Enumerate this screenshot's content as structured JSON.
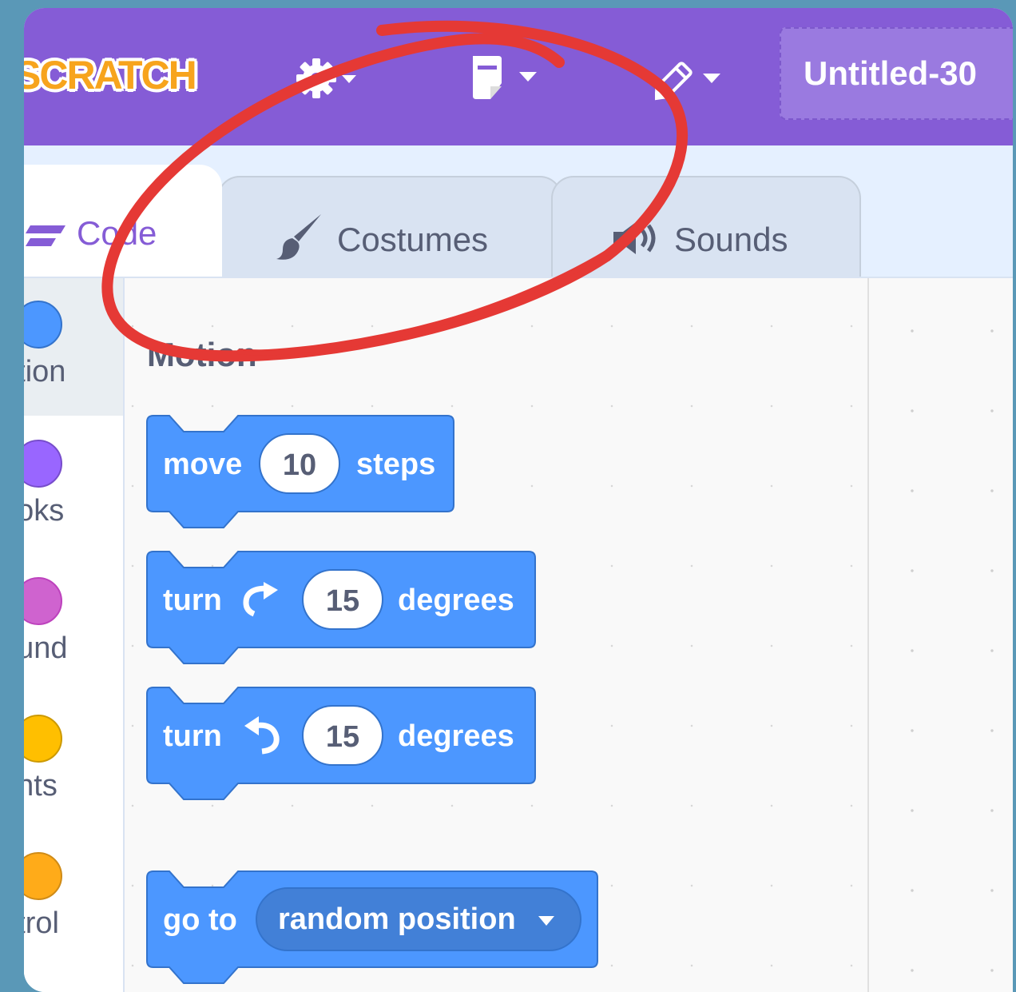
{
  "menubar": {
    "logo_text": "SCRATCH",
    "settings_icon": "gear-icon",
    "file_icon": "file-icon",
    "edit_icon": "edit-pencil-icon",
    "project_title": "Untitled-30",
    "color": "#855cd6"
  },
  "tabs": [
    {
      "label": "Code",
      "icon": "code-icon",
      "active": true
    },
    {
      "label": "Costumes",
      "icon": "paintbrush-icon",
      "active": false
    },
    {
      "label": "Sounds",
      "icon": "speaker-icon",
      "active": false
    }
  ],
  "categories": [
    {
      "label": "otion",
      "color": "#4c97ff",
      "border": "#3373cc"
    },
    {
      "label": "ooks",
      "color": "#9966ff",
      "border": "#774dcb"
    },
    {
      "label": "ound",
      "color": "#cf63cf",
      "border": "#bd42bd"
    },
    {
      "label": "ents",
      "color": "#ffbf00",
      "border": "#cc9900"
    },
    {
      "label": "ntrol",
      "color": "#ffab19",
      "border": "#cf8b17"
    }
  ],
  "flyout": {
    "heading": "Motion",
    "blocks": [
      {
        "parts": [
          "move",
          "10",
          "steps"
        ]
      },
      {
        "parts": [
          "turn",
          "rotate-right-icon",
          "15",
          "degrees"
        ]
      },
      {
        "parts": [
          "turn",
          "rotate-left-icon",
          "15",
          "degrees"
        ]
      },
      {
        "parts": [
          "go to",
          "random position"
        ]
      }
    ]
  },
  "annotation": {
    "shape": "red-circle-annotation",
    "color": "#e53935"
  }
}
